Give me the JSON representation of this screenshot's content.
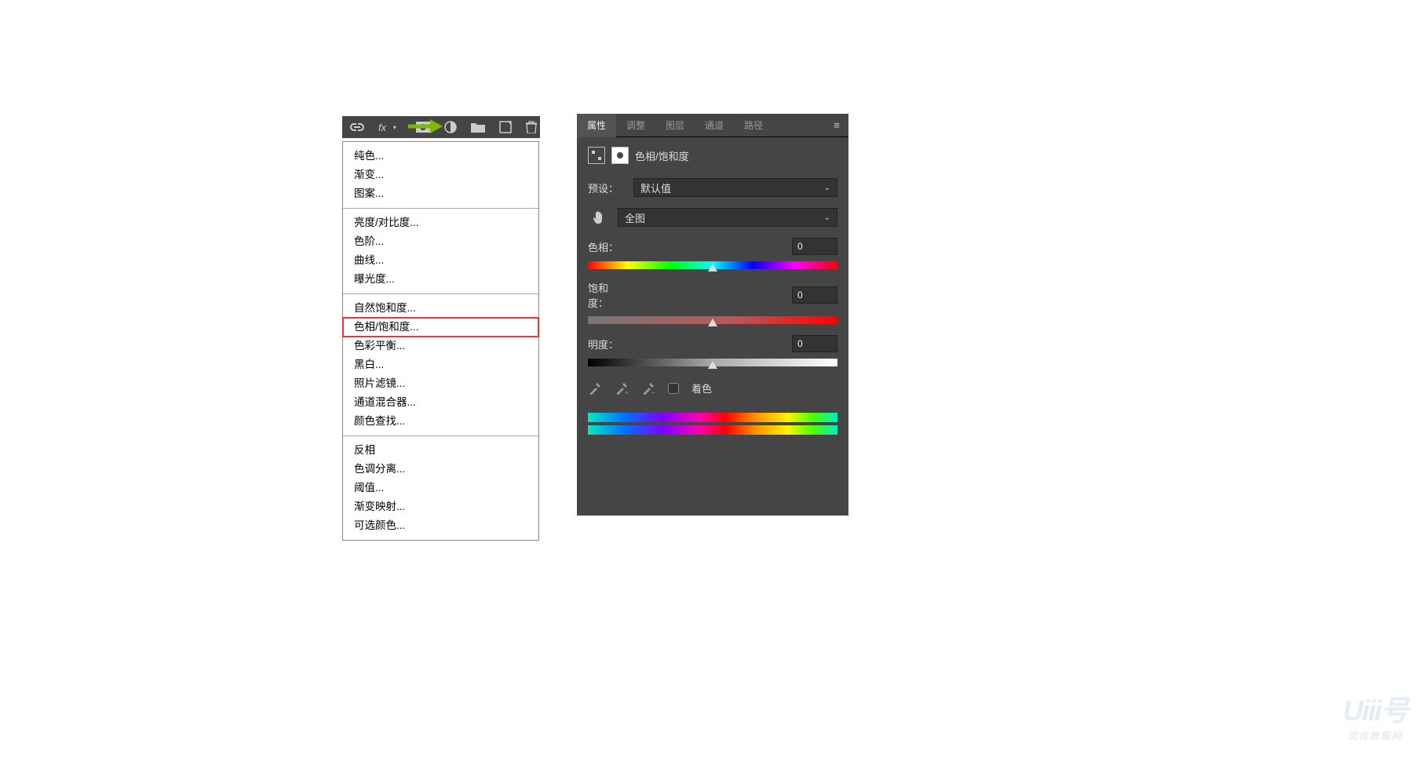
{
  "toolbar_icons": [
    "link",
    "fx",
    "mask",
    "adjustment",
    "folder",
    "new",
    "trash"
  ],
  "menu": {
    "groups": [
      {
        "items": [
          "纯色...",
          "渐变...",
          "图案..."
        ]
      },
      {
        "items": [
          "亮度/对比度...",
          "色阶...",
          "曲线...",
          "曝光度..."
        ]
      },
      {
        "items": [
          "自然饱和度...",
          "色相/饱和度...",
          "色彩平衡...",
          "黑白...",
          "照片滤镜...",
          "通道混合器...",
          "颜色查找..."
        ],
        "highlight": "色相/饱和度..."
      },
      {
        "items": [
          "反相",
          "色调分离...",
          "阈值...",
          "渐变映射...",
          "可选颜色..."
        ]
      }
    ]
  },
  "panel": {
    "tabs": [
      "属性",
      "调整",
      "图层",
      "通道",
      "路径"
    ],
    "active_tab": "属性",
    "title": "色相/饱和度",
    "preset_label": "预设：",
    "preset_value": "默认值",
    "range_value": "全图",
    "sliders": [
      {
        "label": "色相：",
        "value": "0"
      },
      {
        "label": "饱和度：",
        "value": "0"
      },
      {
        "label": "明度：",
        "value": "0"
      }
    ],
    "colorize_label": "着色"
  },
  "watermark": {
    "big": "Uiii号",
    "small": "优优教程网"
  }
}
